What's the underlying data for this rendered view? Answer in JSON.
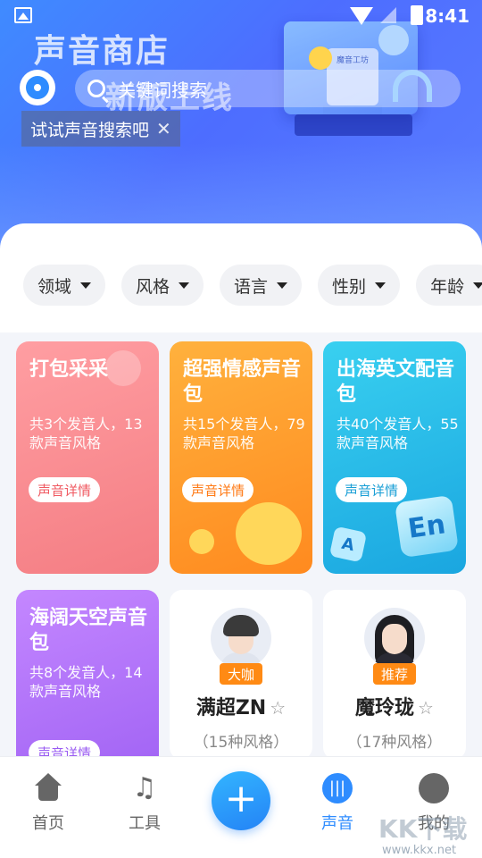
{
  "status_bar": {
    "time": "8:41"
  },
  "banner": {
    "title": "声音商店",
    "subtitle": "新版上线",
    "monitor_label": "魔音工坊"
  },
  "search": {
    "placeholder": "关键词搜索"
  },
  "tip": {
    "text": "试试声音搜索吧",
    "close": "✕"
  },
  "filters": [
    "领域",
    "风格",
    "语言",
    "性别",
    "年龄"
  ],
  "packages": [
    {
      "title": "打包采采",
      "desc": "共3个发音人，13款声音风格",
      "button": "声音详情"
    },
    {
      "title": "超强情感声音包",
      "desc": "共15个发音人，79款声音风格",
      "button": "声音详情"
    },
    {
      "title": "出海英文配音包",
      "desc": "共40个发音人，55款声音风格",
      "button": "声音详情",
      "tile_en": "En",
      "tile_a": "A"
    },
    {
      "title": "海阔天空声音包",
      "desc": "共8个发音人，14款声音风格",
      "button": "声音详情"
    }
  ],
  "speakers": [
    {
      "badge": "大咖",
      "name": "满超ZN",
      "styles": "（15种风格）"
    },
    {
      "badge": "推荐",
      "name": "魔玲珑",
      "styles": "（17种风格）"
    }
  ],
  "nav": {
    "home": "首页",
    "tools": "工具",
    "plus": "+",
    "voice": "声音",
    "me": "我的"
  },
  "watermark": {
    "brand": "KK下载",
    "url": "www.kkx.net"
  },
  "colors": {
    "accent": "#2e8cff",
    "badge": "#ff8a14"
  }
}
